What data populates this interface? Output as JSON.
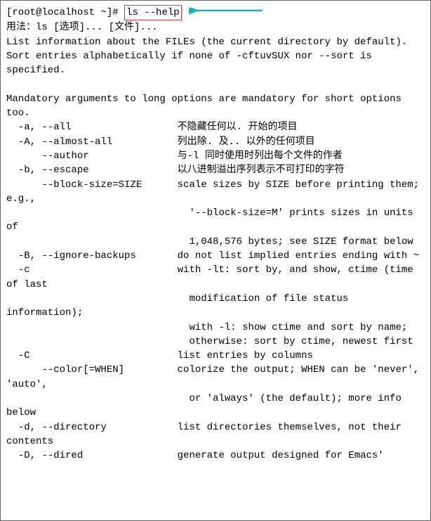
{
  "prompt": {
    "user_host": "[root@localhost ~]#",
    "command": "ls --help"
  },
  "annotation": {
    "arrow_color": "#18b0c8",
    "box_color": "#d04242"
  },
  "output": "用法：ls [选项]... [文件]...\nList information about the FILEs (the current directory by default).\nSort entries alphabetically if none of -cftuvSUX nor --sort is specified.\n\nMandatory arguments to long options are mandatory for short options too.\n  -a, --all                  不隐藏任何以. 开始的项目\n  -A, --almost-all           列出除. 及.. 以外的任何项目\n      --author               与-l 同时使用时列出每个文件的作者\n  -b, --escape               以八进制溢出序列表示不可打印的字符\n      --block-size=SIZE      scale sizes by SIZE before printing them; e.g.,\n                               '--block-size=M' prints sizes in units of\n                               1,048,576 bytes; see SIZE format below\n  -B, --ignore-backups       do not list implied entries ending with ~\n  -c                         with -lt: sort by, and show, ctime (time of last\n                               modification of file status information);\n                               with -l: show ctime and sort by name;\n                               otherwise: sort by ctime, newest first\n  -C                         list entries by columns\n      --color[=WHEN]         colorize the output; WHEN can be 'never', 'auto',\n                               or 'always' (the default); more info below\n  -d, --directory            list directories themselves, not their contents\n  -D, --dired                generate output designed for Emacs'"
}
